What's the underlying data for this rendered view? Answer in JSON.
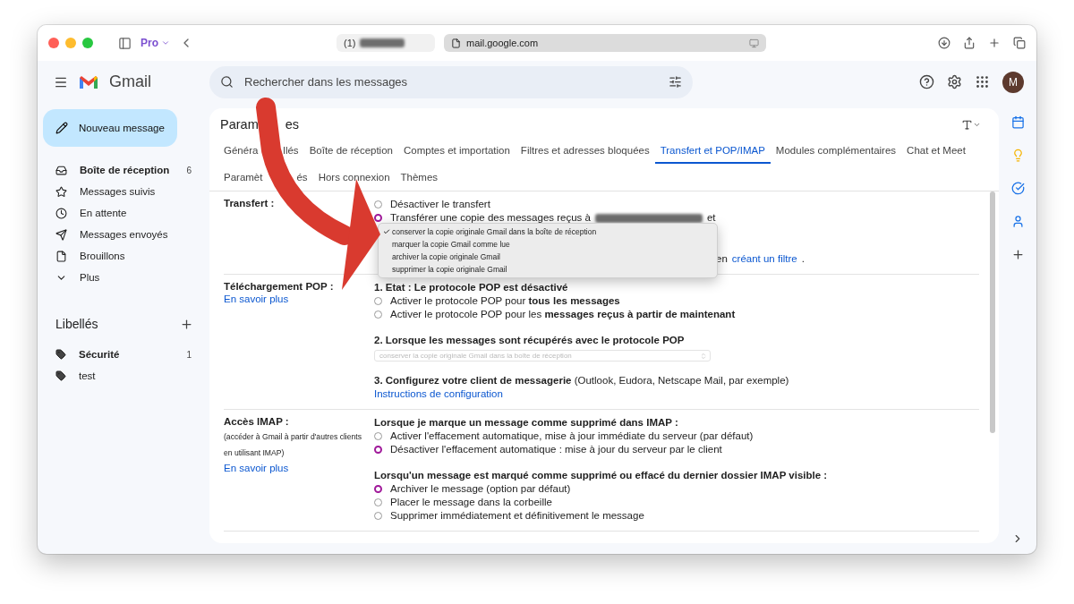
{
  "browser": {
    "profile": "Pro",
    "tab_title": "(1)",
    "url": "mail.google.com"
  },
  "app": {
    "name": "Gmail",
    "search_placeholder": "Rechercher dans les messages",
    "avatar": "M"
  },
  "compose": "Nouveau message",
  "sidebar": {
    "items": [
      {
        "label": "Boîte de réception",
        "count": "6",
        "unread": true
      },
      {
        "label": "Messages suivis",
        "unread": false
      },
      {
        "label": "En attente",
        "unread": false
      },
      {
        "label": "Messages envoyés",
        "unread": false
      },
      {
        "label": "Brouillons",
        "unread": false
      },
      {
        "label": "Plus",
        "unread": false
      }
    ],
    "labels_title": "Libellés",
    "labels": [
      {
        "label": "Sécurité",
        "count": "1",
        "unread": true
      },
      {
        "label": "test",
        "unread": false
      }
    ]
  },
  "settings": {
    "title_parts": [
      "Param",
      "es"
    ],
    "tab_rows": [
      [
        {
          "parts": [
            "Généra",
            "llés"
          ],
          "selected": false
        },
        {
          "parts": [
            "Boîte de réception"
          ],
          "selected": false
        },
        {
          "parts": [
            "Comptes et importation"
          ],
          "selected": false
        },
        {
          "parts": [
            "Filtres et adresses bloquées"
          ],
          "selected": false
        },
        {
          "parts": [
            "Transfert et POP/IMAP"
          ],
          "selected": true
        },
        {
          "parts": [
            "Modules complémentaires"
          ],
          "selected": false
        },
        {
          "parts": [
            "Chat et Meet"
          ],
          "selected": false
        }
      ],
      [
        {
          "parts": [
            "Paramèt",
            "és"
          ],
          "selected": false
        },
        {
          "parts": [
            "Hors connexion"
          ],
          "selected": false
        },
        {
          "parts": [
            "Thèmes"
          ],
          "selected": false
        }
      ]
    ],
    "sections": [
      {
        "label": "Transfert :",
        "blocks": [
          {
            "kind": "radio",
            "text": "Désactiver le transfert",
            "selected": false
          },
          {
            "kind": "forward",
            "text": "Transférer une copie des messages reçus à",
            "after": "et",
            "selected": true
          },
          {
            "kind": "filter",
            "text": "en",
            "link": "créant un filtre",
            "after": "."
          }
        ]
      },
      {
        "label": "Téléchargement POP :",
        "link": "En savoir plus",
        "blocks": [
          {
            "kind": "heading",
            "text": "1. Etat : Le protocole POP est désactivé"
          },
          {
            "kind": "radio",
            "text": "Activer le protocole POP pour **tous les messages**",
            "selected": false
          },
          {
            "kind": "radio",
            "text": "Activer le protocole POP pour les **messages reçus à partir de maintenant**",
            "selected": false
          },
          {
            "kind": "heading",
            "text": "2. Lorsque les messages sont récupérés avec le protocole POP"
          },
          {
            "kind": "select",
            "text": "conserver la copie originale Gmail dans la boîte de réception",
            "disabled": true
          },
          {
            "kind": "paragraph",
            "text": "**3. Configurez votre client de messagerie** (Outlook, Eudora, Netscape Mail, par exemple)"
          },
          {
            "kind": "link",
            "text": "Instructions de configuration"
          }
        ]
      },
      {
        "label": "Accès IMAP :",
        "note": "(accéder à Gmail à partir d'autres clients en utilisant IMAP)",
        "link": "En savoir plus",
        "blocks": [
          {
            "kind": "heading",
            "text": "Lorsque je marque un message comme supprimé dans IMAP :"
          },
          {
            "kind": "radio",
            "text": "Activer l'effacement automatique, mise à jour immédiate du serveur (par défaut)",
            "selected": false
          },
          {
            "kind": "radio",
            "text": "Désactiver l'effacement automatique : mise à jour du serveur par le client",
            "selected": true
          },
          {
            "kind": "heading",
            "text": "Lorsqu'un message est marqué comme supprimé ou effacé du dernier dossier IMAP visible :"
          },
          {
            "kind": "radio",
            "text": "Archiver le message (option par défaut)",
            "selected": true
          },
          {
            "kind": "radio",
            "text": "Placer le message dans la corbeille",
            "selected": false
          },
          {
            "kind": "radio",
            "text": "Supprimer immédiatement et définitivement le message",
            "selected": false
          }
        ]
      }
    ]
  },
  "dropdown": [
    {
      "text": "conserver la copie originale Gmail dans la boîte de réception",
      "selected": true
    },
    {
      "text": "marquer la copie Gmail comme lue",
      "selected": false
    },
    {
      "text": "archiver la copie originale Gmail",
      "selected": false
    },
    {
      "text": "supprimer la copie originale Gmail",
      "selected": false
    }
  ]
}
